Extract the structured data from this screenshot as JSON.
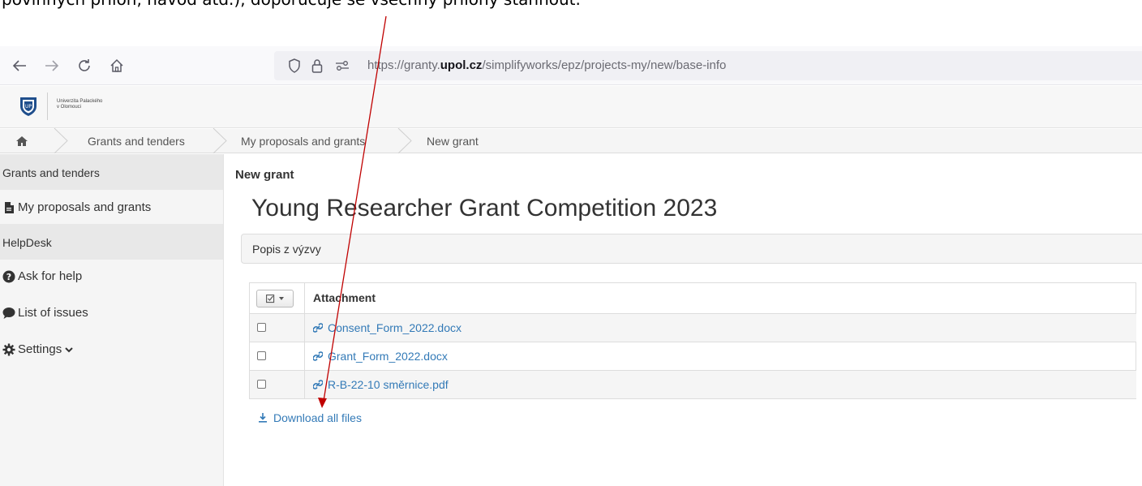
{
  "caption": {
    "text": "povinných příloh, návod atd.), doporučuje se všechny přílohy stáhnout."
  },
  "browser": {
    "url_prefix": "https://granty.",
    "url_domain": "upol.cz",
    "url_path": "/simplifyworks/epz/projects-my/new/base-info",
    "icons": [
      "back-arrow-icon",
      "forward-arrow-icon",
      "reload-icon",
      "home-icon",
      "shield-icon",
      "lock-icon",
      "permissions-icon"
    ]
  },
  "header": {
    "logo_line1": "Univerzita Palackého",
    "logo_line2": "v Olomouci"
  },
  "breadcrumb": {
    "items": [
      "Grants and tenders",
      "My proposals and grants",
      "New grant"
    ]
  },
  "sidebar": {
    "section_grants": "Grants and tenders",
    "item_proposals": "My proposals and grants",
    "section_helpdesk": "HelpDesk",
    "item_ask": "Ask for help",
    "item_issues": "List of issues",
    "item_settings": "Settings"
  },
  "main": {
    "subtitle": "New grant",
    "title": "Young Researcher Grant Competition 2023",
    "panel_label": "Popis z výzvy",
    "table_header": "Attachment",
    "attachments": [
      "Consent_Form_2022.docx",
      "Grant_Form_2022.docx",
      "R-B-22-10 směrnice.pdf"
    ],
    "download_all": "Download all files"
  },
  "colors": {
    "link": "#337ab7",
    "annotation_arrow": "#c00000"
  }
}
